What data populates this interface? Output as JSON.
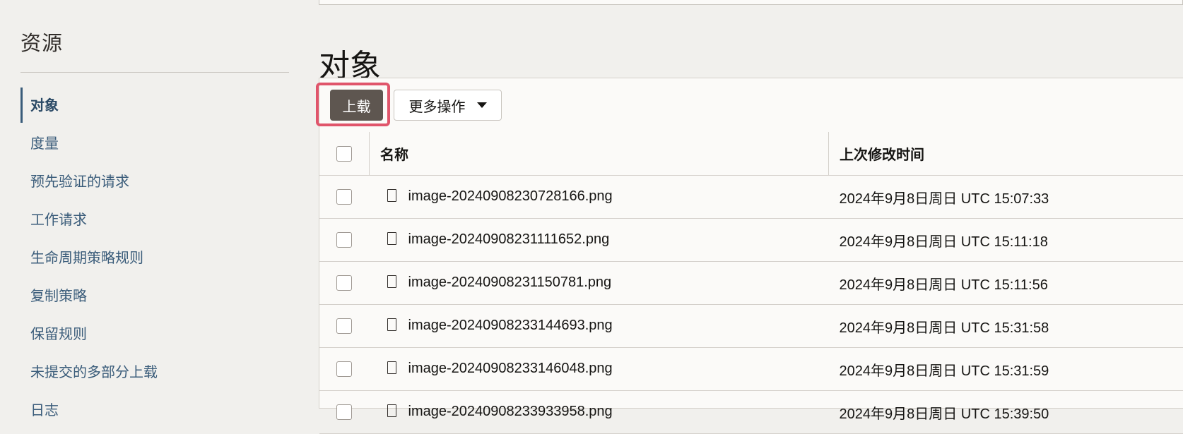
{
  "sidebar": {
    "title": "资源",
    "items": [
      {
        "label": "对象",
        "active": true
      },
      {
        "label": "度量",
        "active": false
      },
      {
        "label": "预先验证的请求",
        "active": false
      },
      {
        "label": "工作请求",
        "active": false
      },
      {
        "label": "生命周期策略规则",
        "active": false
      },
      {
        "label": "复制策略",
        "active": false
      },
      {
        "label": "保留规则",
        "active": false
      },
      {
        "label": "未提交的多部分上载",
        "active": false
      },
      {
        "label": "日志",
        "active": false
      }
    ]
  },
  "main": {
    "title": "对象",
    "toolbar": {
      "upload_label": "上载",
      "more_actions_label": "更多操作"
    },
    "table": {
      "columns": [
        "名称",
        "上次修改时间"
      ],
      "rows": [
        {
          "name": "image-20240908230728166.png",
          "modified": "2024年9月8日周日 UTC 15:07:33"
        },
        {
          "name": "image-20240908231111652.png",
          "modified": "2024年9月8日周日 UTC 15:11:18"
        },
        {
          "name": "image-20240908231150781.png",
          "modified": "2024年9月8日周日 UTC 15:11:56"
        },
        {
          "name": "image-20240908233144693.png",
          "modified": "2024年9月8日周日 UTC 15:31:58"
        },
        {
          "name": "image-20240908233146048.png",
          "modified": "2024年9月8日周日 UTC 15:31:59"
        },
        {
          "name": "image-20240908233933958.png",
          "modified": "2024年9月8日周日 UTC 15:39:50"
        }
      ]
    }
  },
  "colors": {
    "highlight": "#e0556b",
    "upload_button": "#5e5650",
    "nav_link": "#3a5c7a"
  }
}
